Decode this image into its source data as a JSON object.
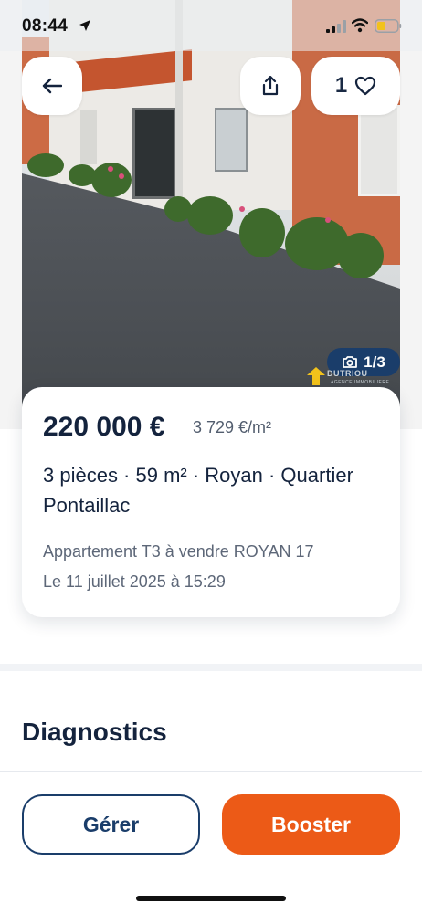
{
  "status_bar": {
    "time": "08:44",
    "icons": [
      "location-arrow-icon",
      "cellular-signal-icon",
      "wifi-icon",
      "battery-icon"
    ],
    "battery_color": "#f2c21b"
  },
  "header": {
    "back_icon": "arrow-left-icon",
    "share_icon": "share-icon",
    "favorite_count": "1",
    "favorite_icon": "heart-outline-icon"
  },
  "photo": {
    "counter": "1/3",
    "counter_icon": "camera-icon",
    "watermark_text": "DUTRIOU",
    "watermark_sub": "AGENCE IMMOBILIERE"
  },
  "listing": {
    "price": "220 000 €",
    "price_per_m2": "3 729 €/m²",
    "features": "3 pièces · 59 m² · Royan · Quartier Pontaillac",
    "title": "Appartement T3 à vendre ROYAN 17",
    "date": "Le 11 juillet 2025 à 15:29"
  },
  "sections": {
    "diagnostics_title": "Diagnostics"
  },
  "actions": {
    "manage_label": "Gérer",
    "boost_label": "Booster"
  },
  "colors": {
    "navy": "#1a3d6a",
    "orange": "#ec5a17",
    "text_dark": "#14233d"
  }
}
